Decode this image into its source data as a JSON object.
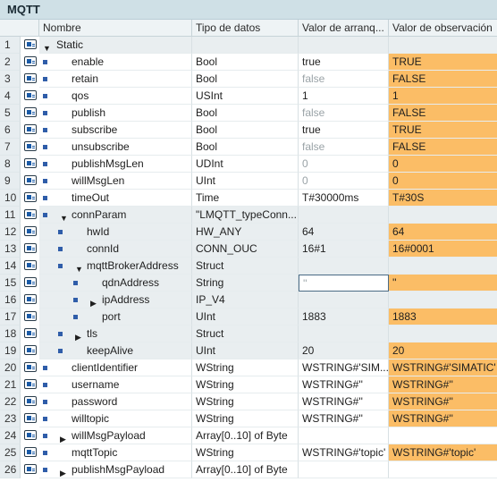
{
  "title": "MQTT",
  "columns": [
    "",
    "Nombre",
    "Tipo de datos",
    "Valor de arranq...",
    "Valor de observación"
  ],
  "rows": [
    {
      "num": "1",
      "indent": 0,
      "toggle": "open",
      "bullet": false,
      "pin": true,
      "name": "Static",
      "type": "",
      "start": "",
      "obs": "",
      "grey": true,
      "startMuted": false,
      "obsOrange": false
    },
    {
      "num": "2",
      "indent": 1,
      "toggle": "",
      "bullet": true,
      "pin": true,
      "name": "enable",
      "type": "Bool",
      "start": "true",
      "obs": "TRUE",
      "grey": false,
      "startMuted": false,
      "obsOrange": true
    },
    {
      "num": "3",
      "indent": 1,
      "toggle": "",
      "bullet": true,
      "pin": true,
      "name": "retain",
      "type": "Bool",
      "start": "false",
      "obs": "FALSE",
      "grey": false,
      "startMuted": true,
      "obsOrange": true
    },
    {
      "num": "4",
      "indent": 1,
      "toggle": "",
      "bullet": true,
      "pin": true,
      "name": "qos",
      "type": "USInt",
      "start": "1",
      "obs": "1",
      "grey": false,
      "startMuted": false,
      "obsOrange": true
    },
    {
      "num": "5",
      "indent": 1,
      "toggle": "",
      "bullet": true,
      "pin": true,
      "name": "publish",
      "type": "Bool",
      "start": "false",
      "obs": "FALSE",
      "grey": false,
      "startMuted": true,
      "obsOrange": true
    },
    {
      "num": "6",
      "indent": 1,
      "toggle": "",
      "bullet": true,
      "pin": true,
      "name": "subscribe",
      "type": "Bool",
      "start": "true",
      "obs": "TRUE",
      "grey": false,
      "startMuted": false,
      "obsOrange": true
    },
    {
      "num": "7",
      "indent": 1,
      "toggle": "",
      "bullet": true,
      "pin": true,
      "name": "unsubscribe",
      "type": "Bool",
      "start": "false",
      "obs": "FALSE",
      "grey": false,
      "startMuted": true,
      "obsOrange": true
    },
    {
      "num": "8",
      "indent": 1,
      "toggle": "",
      "bullet": true,
      "pin": true,
      "name": "publishMsgLen",
      "type": "UDInt",
      "start": "0",
      "obs": "0",
      "grey": false,
      "startMuted": true,
      "obsOrange": true
    },
    {
      "num": "9",
      "indent": 1,
      "toggle": "",
      "bullet": true,
      "pin": true,
      "name": "willMsgLen",
      "type": "UInt",
      "start": "0",
      "obs": "0",
      "grey": false,
      "startMuted": true,
      "obsOrange": true
    },
    {
      "num": "10",
      "indent": 1,
      "toggle": "",
      "bullet": true,
      "pin": true,
      "name": "timeOut",
      "type": "Time",
      "start": "T#30000ms",
      "obs": "T#30S",
      "grey": false,
      "startMuted": false,
      "obsOrange": true
    },
    {
      "num": "11",
      "indent": 1,
      "toggle": "open",
      "bullet": true,
      "pin": true,
      "name": "connParam",
      "type": "\"LMQTT_typeConn...",
      "start": "",
      "obs": "",
      "grey": true,
      "startMuted": false,
      "obsOrange": false
    },
    {
      "num": "12",
      "indent": 2,
      "toggle": "",
      "bullet": true,
      "pin": true,
      "name": "hwId",
      "type": "HW_ANY",
      "start": "64",
      "obs": "64",
      "grey": true,
      "startMuted": false,
      "obsOrange": true
    },
    {
      "num": "13",
      "indent": 2,
      "toggle": "",
      "bullet": true,
      "pin": true,
      "name": "connId",
      "type": "CONN_OUC",
      "start": "16#1",
      "obs": "16#0001",
      "grey": true,
      "startMuted": false,
      "obsOrange": true
    },
    {
      "num": "14",
      "indent": 2,
      "toggle": "open",
      "bullet": true,
      "pin": true,
      "name": "mqttBrokerAddress",
      "type": "Struct",
      "start": "",
      "obs": "",
      "grey": true,
      "startMuted": false,
      "obsOrange": false
    },
    {
      "num": "15",
      "indent": 3,
      "toggle": "",
      "bullet": true,
      "pin": true,
      "name": "qdnAddress",
      "type": "String",
      "start": "''",
      "obs": "''",
      "grey": true,
      "startMuted": true,
      "obsOrange": true,
      "selected": true
    },
    {
      "num": "16",
      "indent": 3,
      "toggle": "closed",
      "bullet": true,
      "pin": true,
      "name": "ipAddress",
      "type": "IP_V4",
      "start": "",
      "obs": "",
      "grey": true,
      "startMuted": false,
      "obsOrange": false
    },
    {
      "num": "17",
      "indent": 3,
      "toggle": "",
      "bullet": true,
      "pin": true,
      "name": "port",
      "type": "UInt",
      "start": "1883",
      "obs": "1883",
      "grey": true,
      "startMuted": false,
      "obsOrange": true
    },
    {
      "num": "18",
      "indent": 2,
      "toggle": "closed",
      "bullet": true,
      "pin": true,
      "name": "tls",
      "type": "Struct",
      "start": "",
      "obs": "",
      "grey": true,
      "startMuted": false,
      "obsOrange": false
    },
    {
      "num": "19",
      "indent": 2,
      "toggle": "",
      "bullet": true,
      "pin": true,
      "name": "keepAlive",
      "type": "UInt",
      "start": "20",
      "obs": "20",
      "grey": true,
      "startMuted": false,
      "obsOrange": true
    },
    {
      "num": "20",
      "indent": 1,
      "toggle": "",
      "bullet": true,
      "pin": true,
      "name": "clientIdentifier",
      "type": "WString",
      "start": "WSTRING#'SIM...",
      "obs": "WSTRING#'SIMATIC'",
      "grey": false,
      "startMuted": false,
      "obsOrange": true
    },
    {
      "num": "21",
      "indent": 1,
      "toggle": "",
      "bullet": true,
      "pin": true,
      "name": "username",
      "type": "WString",
      "start": "WSTRING#''",
      "obs": "WSTRING#''",
      "grey": false,
      "startMuted": false,
      "obsOrange": true
    },
    {
      "num": "22",
      "indent": 1,
      "toggle": "",
      "bullet": true,
      "pin": true,
      "name": "password",
      "type": "WString",
      "start": "WSTRING#''",
      "obs": "WSTRING#''",
      "grey": false,
      "startMuted": false,
      "obsOrange": true
    },
    {
      "num": "23",
      "indent": 1,
      "toggle": "",
      "bullet": true,
      "pin": true,
      "name": "willtopic",
      "type": "WString",
      "start": "WSTRING#''",
      "obs": "WSTRING#''",
      "grey": false,
      "startMuted": false,
      "obsOrange": true
    },
    {
      "num": "24",
      "indent": 1,
      "toggle": "closed",
      "bullet": true,
      "pin": true,
      "name": "willMsgPayload",
      "type": "Array[0..10] of Byte",
      "start": "",
      "obs": "",
      "grey": false,
      "startMuted": false,
      "obsOrange": false
    },
    {
      "num": "25",
      "indent": 1,
      "toggle": "",
      "bullet": true,
      "pin": true,
      "name": "mqttTopic",
      "type": "WString",
      "start": "WSTRING#'topic'",
      "obs": "WSTRING#'topic'",
      "grey": false,
      "startMuted": false,
      "obsOrange": true
    },
    {
      "num": "26",
      "indent": 1,
      "toggle": "closed",
      "bullet": true,
      "pin": true,
      "name": "publishMsgPayload",
      "type": "Array[0..10] of Byte",
      "start": "",
      "obs": "",
      "grey": false,
      "startMuted": false,
      "obsOrange": false
    }
  ]
}
